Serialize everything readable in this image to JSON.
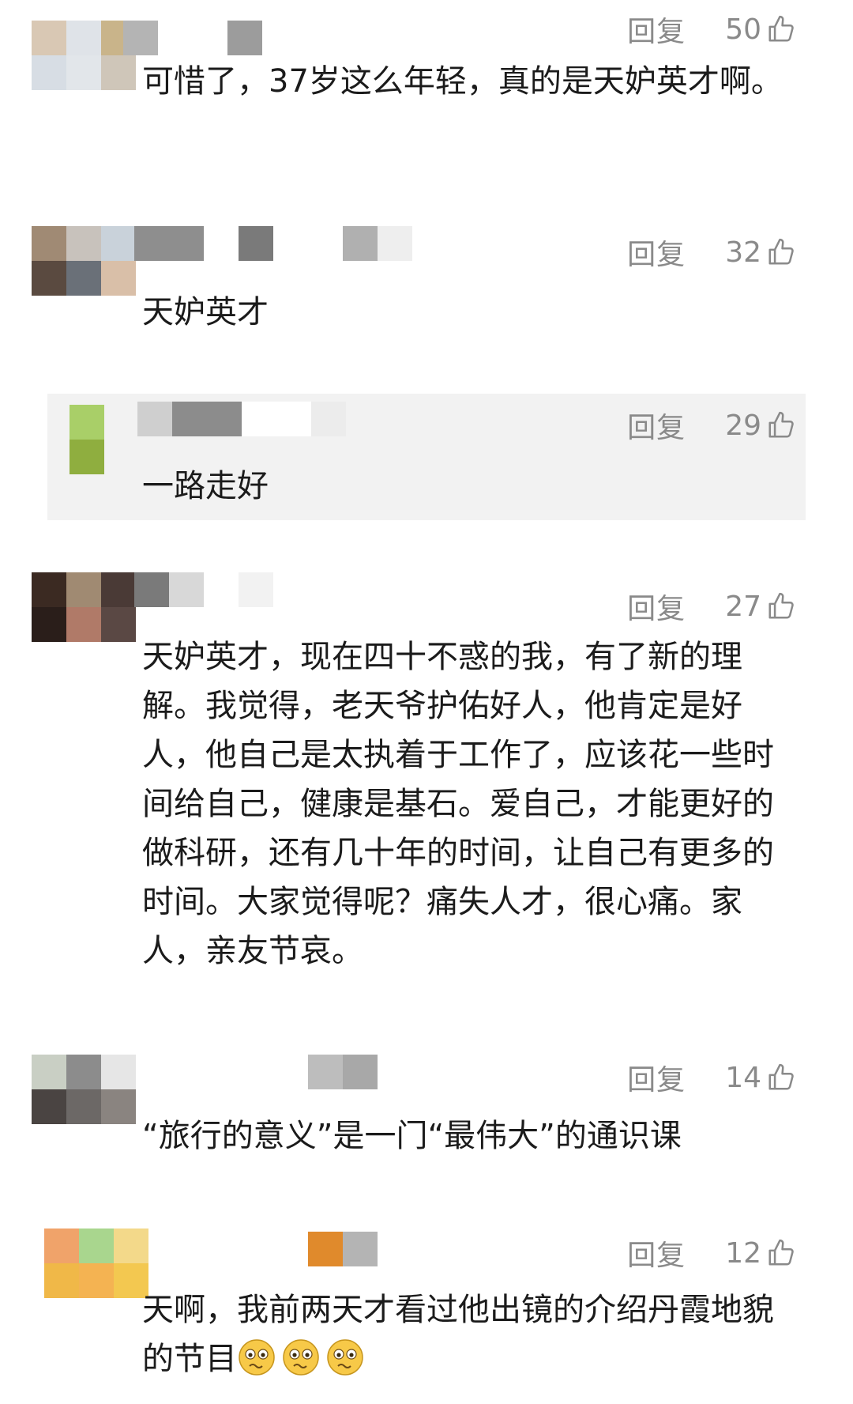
{
  "comments": [
    {
      "reply_label": "回复",
      "likes": "50",
      "text": "可惜了，37岁这么年轻，真的是天妒英才啊。",
      "avatar": [
        "#d9c8b4",
        "#dfe3e8",
        "#c9b48a",
        "#d7dde4",
        "#e2e6ea",
        "#cfc6b9"
      ],
      "name": [
        "#b4b4b4",
        "#ffffff",
        "#ffffff",
        "#9c9c9c"
      ]
    },
    {
      "reply_label": "回复",
      "likes": "32",
      "text": "天妒英才",
      "avatar": [
        "#a08a74",
        "#c8c2bc",
        "#c9d2da",
        "#5a4a40",
        "#6a7078",
        "#d9bfa8"
      ],
      "name": [
        "#8e8e8e",
        "#8e8e8e",
        "#ffffff",
        "#7a7a7a",
        "#ffffff",
        "#ffffff",
        "#b0b0b0",
        "#eeeeee"
      ]
    },
    {
      "reply_label": "回复",
      "likes": "29",
      "text": "一路走好",
      "avatar": [
        "#a9cf68",
        "#8fae3f"
      ],
      "name": [
        "#cfcfcf",
        "#8c8c8c",
        "#8c8c8c",
        "#ffffff",
        "#ffffff",
        "#ececec"
      ]
    },
    {
      "reply_label": "回复",
      "likes": "27",
      "text": "天妒英才，现在四十不惑的我，有了新的理解。我觉得，老天爷护佑好人，他肯定是好人，他自己是太执着于工作了，应该花一些时间给自己，健康是基石。爱自己，才能更好的做科研，还有几十年的时间，让自己有更多的时间。大家觉得呢？痛失人才，很心痛。家人，亲友节哀。",
      "avatar": [
        "#3b2a22",
        "#a08a72",
        "#4a3a36",
        "#2a1e1a",
        "#b07a68",
        "#5a4844"
      ],
      "name": [
        "#7a7a7a",
        "#d8d8d8",
        "#ffffff",
        "#f2f2f2"
      ]
    },
    {
      "reply_label": "回复",
      "likes": "14",
      "text": "“旅行的意义”是一门“最伟大”的通识课",
      "avatar": [
        "#c9cfc4",
        "#8c8c8c",
        "#e6e6e6",
        "#4a4442",
        "#6c6866",
        "#8a8480"
      ],
      "name": [
        "#ffffff",
        "#ffffff",
        "#ffffff",
        "#ffffff",
        "#bdbdbd",
        "#a8a8a8"
      ]
    },
    {
      "reply_label": "回复",
      "likes": "12",
      "text": "天啊，我前两天才看过他出镜的介绍丹霞地貌的节目",
      "emoji_count": 3,
      "avatar": [
        "#f0a36a",
        "#a9d68e",
        "#f3d98a",
        "#f0b848",
        "#f4b352",
        "#f3c850"
      ],
      "name": [
        "#ffffff",
        "#ffffff",
        "#ffffff",
        "#ffffff",
        "#e08a2c",
        "#b4b4b4"
      ]
    }
  ],
  "colors": {
    "text": "#1b1b1b",
    "meta": "#8a8a8a",
    "highlight_bg": "#f2f2f2"
  },
  "icons": {
    "like": "thumbs-up-icon",
    "emoji": "woozy-face-icon"
  }
}
